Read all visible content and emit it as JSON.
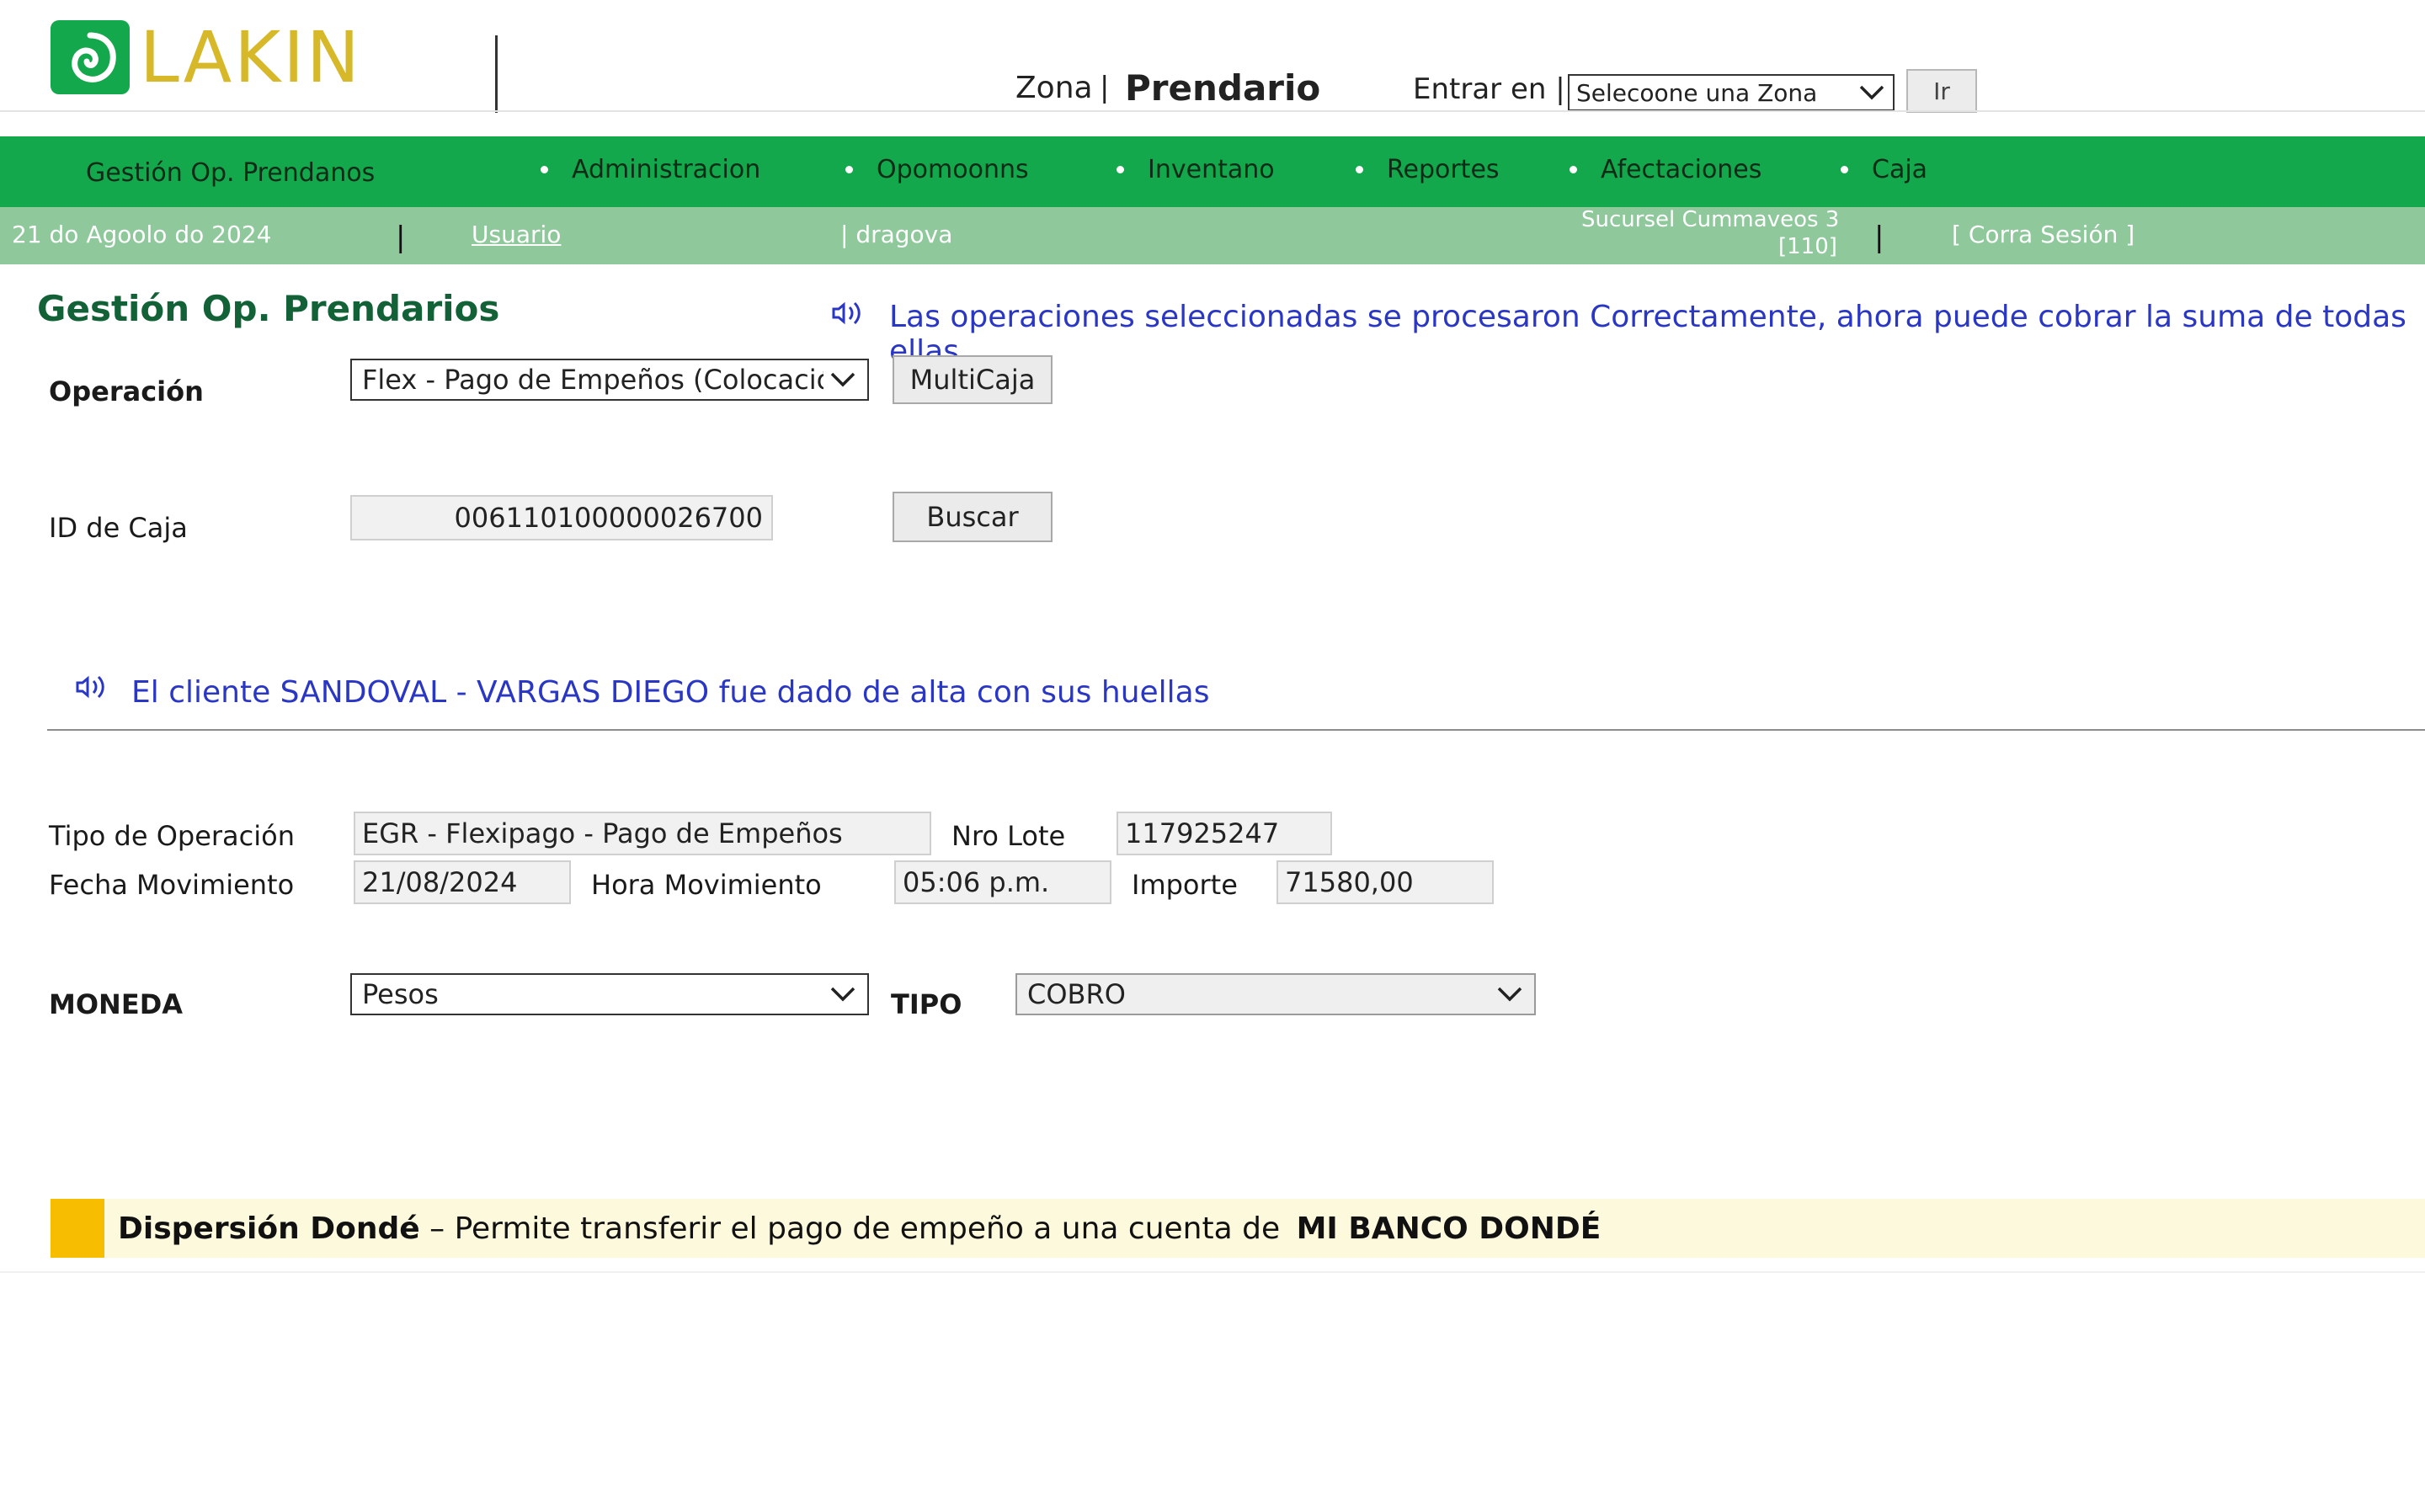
{
  "header": {
    "logo_text": "LAKIN",
    "zona_label": "Zona",
    "zona_sep": "|",
    "zona_value": "Prendario",
    "entrar_label": "Entrar en",
    "entrar_sep": "|",
    "zone_select_value": "Selecoone una Zona",
    "ir_button": "Ir"
  },
  "nav": {
    "items": [
      "Gestión Op. Prendanos",
      "Administracion",
      "Opomoonns",
      "Inventano",
      "Reportes",
      "Afectaciones",
      "Caja"
    ]
  },
  "subbar": {
    "date": "21 do Agoolo do 2024",
    "user_link": "Usuario",
    "user_name": "| dragova",
    "branch_line1": "Sucursel Cummaveos 3",
    "branch_line2": "[110]",
    "logout": "[ Corra Sesión ]",
    "sep": "|"
  },
  "main": {
    "title": "Gestión Op. Prendarios",
    "success_message": "Las operaciones seleccionadas se procesaron Correctamente, ahora puede cobrar la suma de todas ellas",
    "operacion_label": "Operación",
    "operacion_value": "Flex - Pago de Empeños (Colocación)",
    "multicaja_button": "MultiCaja",
    "id_caja_label": "ID de Caja",
    "id_caja_value": "006110100000026700",
    "buscar_button": "Buscar",
    "client_message": "El cliente SANDOVAL - VARGAS DIEGO fue dado de alta con sus huellas"
  },
  "details": {
    "tipo_operacion_label": "Tipo de Operación",
    "tipo_operacion_value": "EGR - Flexipago - Pago de Empeños",
    "nro_lote_label": "Nro Lote",
    "nro_lote_value": "117925247",
    "fecha_label": "Fecha Movimiento",
    "fecha_value": "21/08/2024",
    "hora_label": "Hora Movimiento",
    "hora_value": "05:06 p.m.",
    "importe_label": "Importe",
    "importe_value": "71580,00"
  },
  "payment": {
    "moneda_label": "MONEDA",
    "moneda_value": "Pesos",
    "tipo_label": "TIPO",
    "tipo_value": "COBRO"
  },
  "banner": {
    "title": "Dispersión Dondé",
    "text": " – Permite transferir el pago de empeño a una cuenta de ",
    "bank": "MI BANCO DONDÉ"
  },
  "colors": {
    "nav_green": "#12a84b",
    "sub_green": "#8ec89b",
    "title_green": "#136237",
    "message_blue": "#2a36c4",
    "logo_yellow": "#d6b829",
    "banner_accent": "#f7bd00"
  }
}
